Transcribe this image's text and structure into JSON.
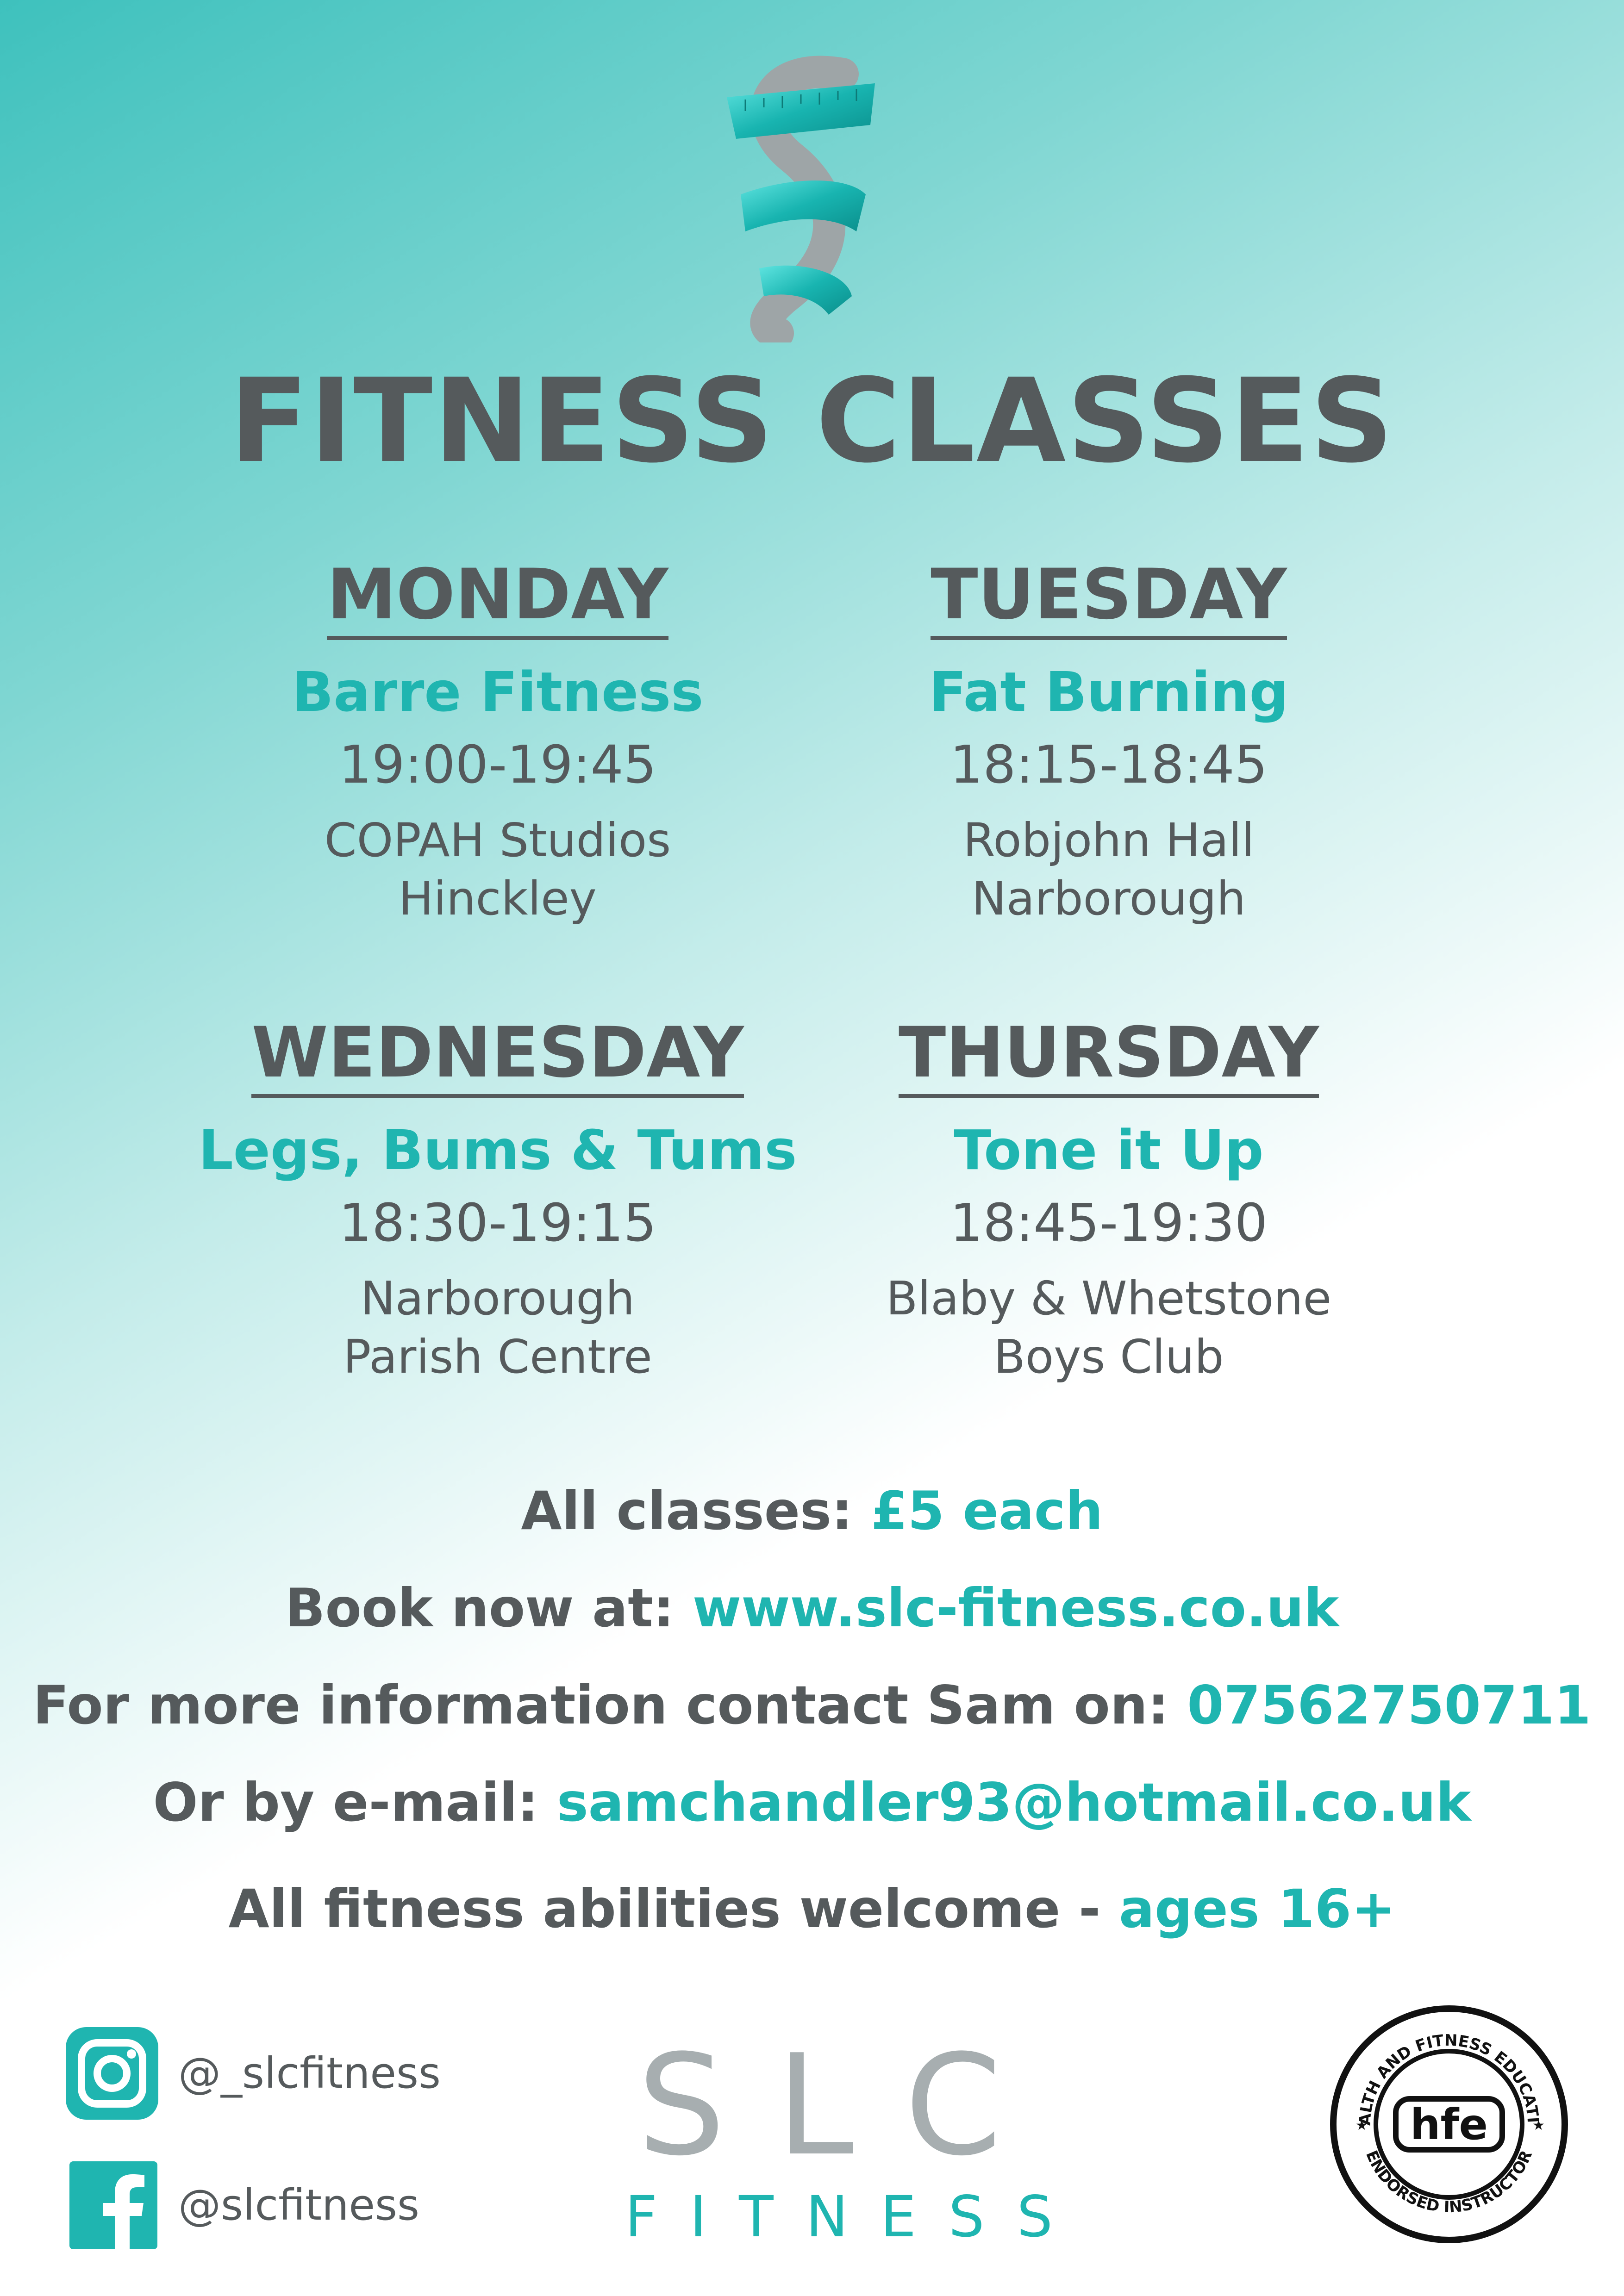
{
  "title": "FITNESS CLASSES",
  "classes": [
    {
      "day": "MONDAY",
      "name": "Barre Fitness",
      "time": "19:00-19:45",
      "venue_line1": "COPAH Studios",
      "venue_line2": "Hinckley"
    },
    {
      "day": "TUESDAY",
      "name": "Fat Burning",
      "time": "18:15-18:45",
      "venue_line1": "Robjohn Hall",
      "venue_line2": "Narborough"
    },
    {
      "day": "WEDNESDAY",
      "name": "Legs, Bums & Tums",
      "time": "18:30-19:15",
      "venue_line1": "Narborough",
      "venue_line2": "Parish Centre"
    },
    {
      "day": "THURSDAY",
      "name": "Tone it Up",
      "time": "18:45-19:30",
      "venue_line1": "Blaby & Whetstone",
      "venue_line2": "Boys Club"
    }
  ],
  "info": {
    "price_label": "All classes:",
    "price_value": "£5 each",
    "book_label": "Book now at:",
    "book_value": "www.slc-fitness.co.uk",
    "contact_label": "For more information contact Sam on:",
    "contact_value": "07562750711",
    "email_label": "Or by e-mail:",
    "email_value": "samchandler93@hotmail.co.uk",
    "welcome_label": "All fitness abilities welcome -",
    "welcome_value": "ages 16+"
  },
  "social": {
    "instagram_handle": "@_slcfitness",
    "facebook_handle": "@slcfitness"
  },
  "brand": {
    "main": "SLC",
    "sub": "FITNESS"
  },
  "badge": {
    "text_top": "HEALTH AND FITNESS EDUCATION",
    "text_bottom": "ENDORSED INSTRUCTOR",
    "mark": "hfe"
  },
  "colors": {
    "accent": "#1fb5b0",
    "text": "#555a5c",
    "brand_grey": "#a7aeb0"
  },
  "icons": {
    "instagram": "instagram-icon",
    "facebook": "facebook-icon",
    "logo": "measuring-tape-s-logo",
    "badge": "hfe-badge"
  }
}
